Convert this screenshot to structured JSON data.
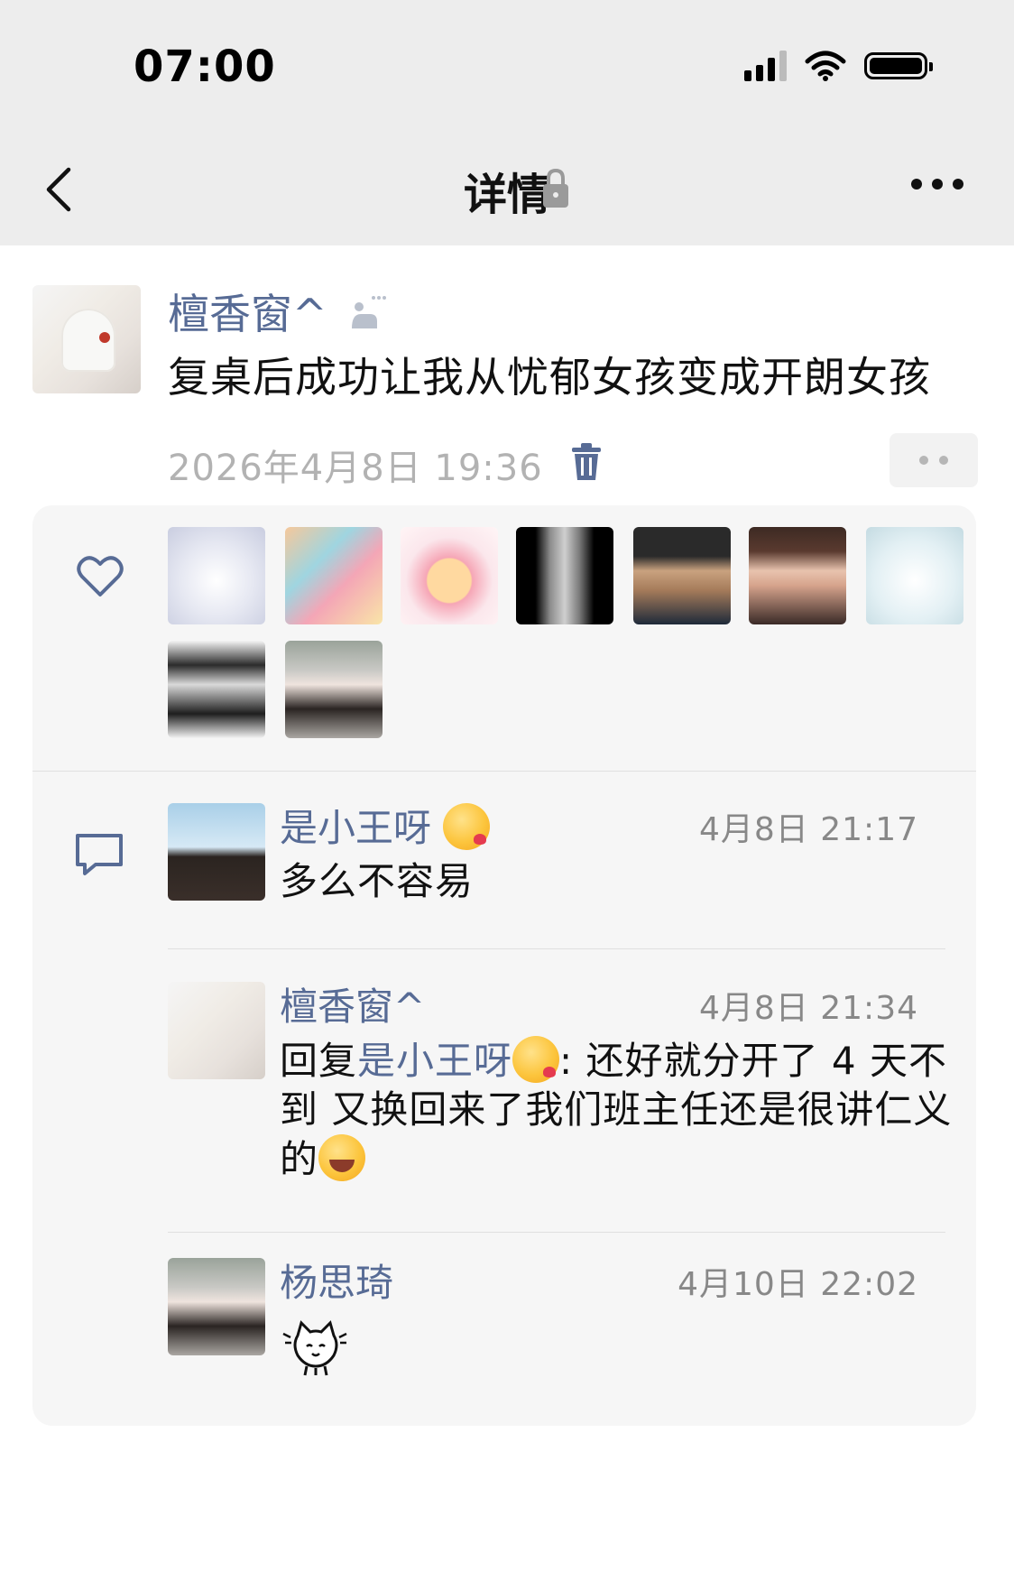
{
  "status_bar": {
    "time": "07:00"
  },
  "nav": {
    "title": "详情",
    "back_icon": "chevron-left-icon",
    "lock_icon": "lock-icon",
    "more_icon": "more-dots-icon"
  },
  "post": {
    "author": "檀香窗^",
    "content": "复桌后成功让我从忧郁女孩变成开朗女孩",
    "time": "2026年4月8日 19:36",
    "delete_icon": "trash-icon"
  },
  "likes": {
    "icon": "heart-icon"
  },
  "comments": {
    "icon": "comment-icon",
    "items": [
      {
        "name": "是小王呀",
        "time": "4月8日 21:17",
        "text": "多么不容易"
      },
      {
        "name": "檀香窗^",
        "time": "4月8日 21:34",
        "reply_prefix": "回复",
        "reply_target": "是小王呀",
        "text_after": ": 还好就分开了 4 天不到 又换回来了我们班主任还是很讲仁义的"
      },
      {
        "name": "杨思琦",
        "time": "4月10日 22:02"
      }
    ]
  },
  "colors": {
    "name_blue": "#576b95",
    "nav_background": "#ededed",
    "card_background": "#f6f6f6",
    "timestamp_gray": "#b2b2b2"
  }
}
